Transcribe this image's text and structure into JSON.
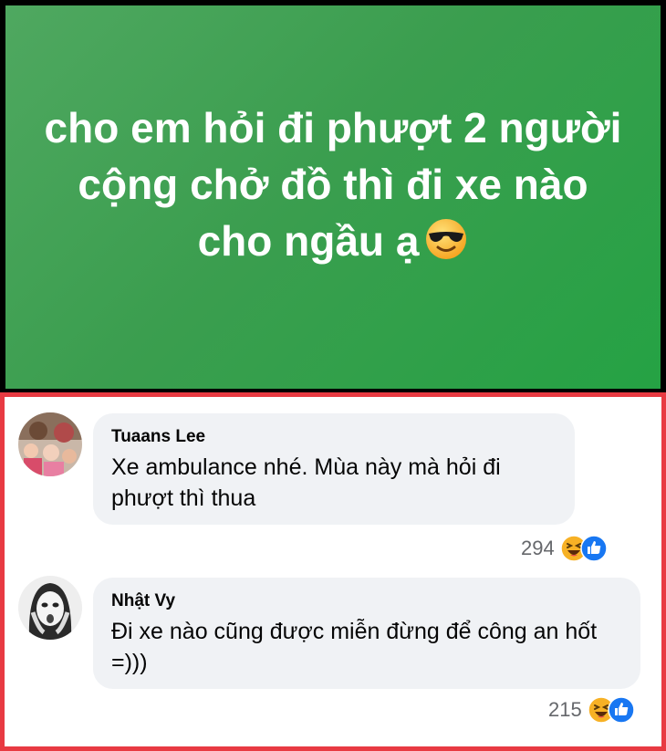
{
  "post": {
    "text": "cho em hỏi đi phượt 2 người cộng chở đồ thì đi xe nào cho ngầu ạ",
    "background_color": "#3b9e4f",
    "emoji": "smiling-face-with-sunglasses-icon"
  },
  "comments": [
    {
      "author": "Tuaans Lee",
      "text": "Xe ambulance nhé. Mùa này mà hỏi đi phượt thì thua",
      "reaction_count": "294",
      "reactions": [
        "haha-icon",
        "like-icon"
      ]
    },
    {
      "author": "Nhật Vy",
      "text": "Đi xe nào cũng được miễn đừng để công an hốt =)))",
      "reaction_count": "215",
      "reactions": [
        "haha-icon",
        "like-icon"
      ]
    }
  ],
  "colors": {
    "highlight_border": "#e83a42",
    "bubble": "#f0f2f5",
    "like_blue": "#1877f2",
    "haha_yellow": "#f7b125"
  }
}
